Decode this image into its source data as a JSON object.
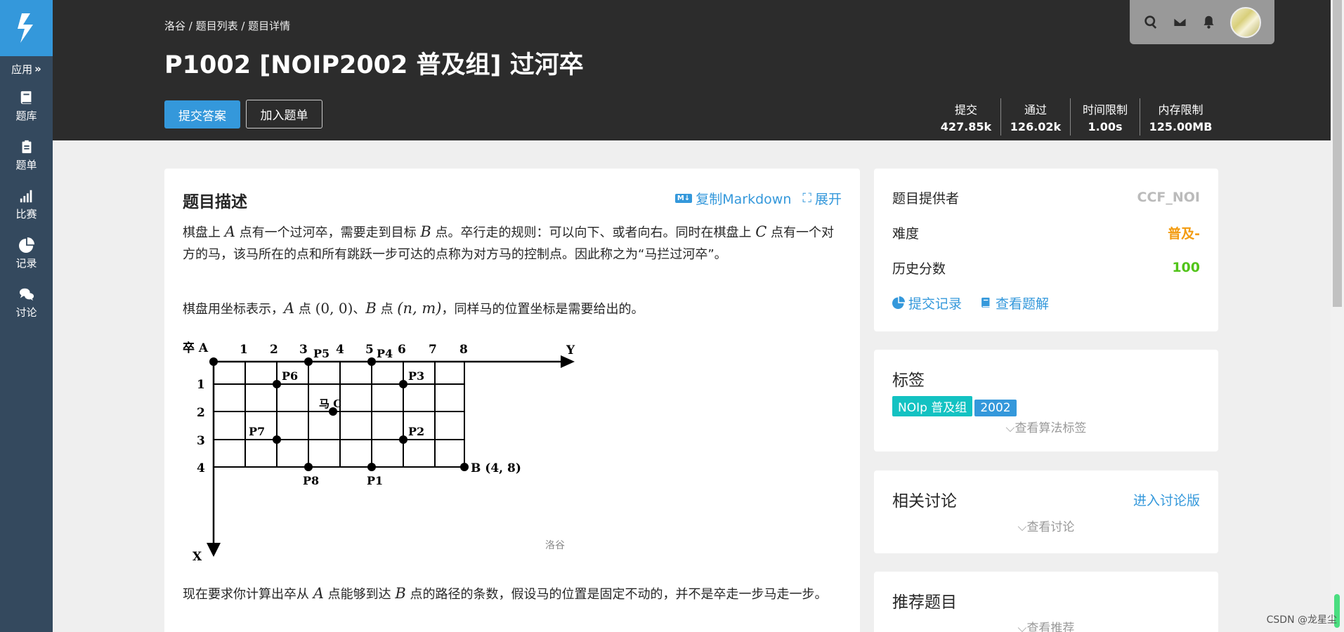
{
  "sidebar": {
    "apps_label": "应用",
    "items": [
      {
        "label": "题库"
      },
      {
        "label": "题单"
      },
      {
        "label": "比赛"
      },
      {
        "label": "记录"
      },
      {
        "label": "讨论"
      }
    ]
  },
  "header": {
    "breadcrumb": "洛谷 / 题目列表 / 题目详情",
    "title": "P1002 [NOIP2002 普及组] 过河卒",
    "submit_label": "提交答案",
    "add_list_label": "加入题单",
    "stats": [
      {
        "label": "提交",
        "value": "427.85k"
      },
      {
        "label": "通过",
        "value": "126.02k"
      },
      {
        "label": "时间限制",
        "value": "1.00s"
      },
      {
        "label": "内存限制",
        "value": "125.00MB"
      }
    ]
  },
  "problem": {
    "heading": "题目描述",
    "copy_markdown": "复制Markdown",
    "expand": "展开",
    "p1_a": "棋盘上 ",
    "p1_m1": "A",
    "p1_b": " 点有一个过河卒，需要走到目标 ",
    "p1_m2": "B",
    "p1_c": " 点。卒行走的规则：可以向下、或者向右。同时在棋盘上 ",
    "p1_m3": "C",
    "p1_d": " 点有一个对方的马，该马所在的点和所有跳跃一步可达的点称为对方马的控制点。因此称之为“马拦过河卒”。",
    "p2_a": "棋盘用坐标表示，",
    "p2_m1": "A",
    "p2_b": " 点 ",
    "p2_m2": "(0, 0)",
    "p2_c": "、",
    "p2_m3": "B",
    "p2_d": " 点 ",
    "p2_m4": "(n, m)",
    "p2_e": "，同样马的位置坐标是需要给出的。",
    "p3_a": "现在要求你计算出卒从 ",
    "p3_m1": "A",
    "p3_b": " 点能够到达 ",
    "p3_m2": "B",
    "p3_c": " 点的路径的条数，假设马的位置是固定不动的，并不是卒走一步马走一步。"
  },
  "figure": {
    "corner": "卒 A",
    "y_axis": "Y",
    "x_axis": "X",
    "cols": [
      "1",
      "2",
      "3",
      "4",
      "5",
      "6",
      "7",
      "8"
    ],
    "rows": [
      "1",
      "2",
      "3",
      "4"
    ],
    "p1": "P1",
    "p2": "P2",
    "p3": "P3",
    "p4": "P4",
    "p5": "P5",
    "p6": "P6",
    "p7": "P7",
    "p8": "P8",
    "horse": "马 C",
    "target": "B (4, 8)",
    "watermark": "洛谷"
  },
  "info": {
    "provider_label": "题目提供者",
    "provider_value": "CCF_NOI",
    "difficulty_label": "难度",
    "difficulty_value": "普及-",
    "history_label": "历史分数",
    "history_value": "100",
    "records_link": "提交记录",
    "solutions_link": "查看题解",
    "difficulty_color": "#f39c11",
    "score_color": "#52c41a"
  },
  "tags_card": {
    "title": "标签",
    "tags": [
      {
        "label": "NOIp 普及组",
        "color": "#13c2c2"
      },
      {
        "label": "2002",
        "color": "#3498db"
      }
    ],
    "more": "查看算法标签"
  },
  "discuss_card": {
    "title": "相关讨论",
    "link": "进入讨论版",
    "more": "查看讨论"
  },
  "recommend_card": {
    "title": "推荐题目",
    "more": "查看推荐"
  },
  "watermark": "CSDN @龙星尘"
}
